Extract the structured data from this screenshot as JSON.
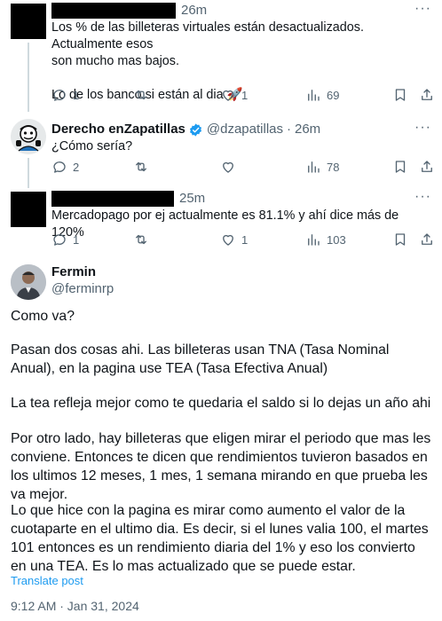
{
  "replies": [
    {
      "time": "26m",
      "text_lines": [
        "Los % de las billeteras virtuales están desactualizados. Actualmente esos",
        "son mucho mas bajos.",
        "",
        "Lo de los banco si están al dia 🚀"
      ],
      "replies_count": "1",
      "retweets_count": "",
      "likes_count": "1",
      "views_count": "69"
    },
    {
      "display_name": "Derecho enZapatillas",
      "handle": "@dzapatillas",
      "sep": "·",
      "time": "26m",
      "text_lines": [
        "¿Cómo sería?"
      ],
      "replies_count": "2",
      "retweets_count": "",
      "likes_count": "",
      "views_count": "78"
    },
    {
      "time": "25m",
      "text_lines": [
        "Mercadopago por ej actualmente es 81.1% y ahí dice más de 120%"
      ],
      "replies_count": "1",
      "retweets_count": "",
      "likes_count": "1",
      "views_count": "103"
    }
  ],
  "main_post": {
    "display_name": "Fermin",
    "handle": "@ferminrp",
    "paragraphs": [
      "Como va?",
      "Pasan dos cosas ahi. Las billeteras usan TNA (Tasa Nominal Anual), en la pagina use TEA (Tasa Efectiva Anual)",
      "La tea refleja mejor como te quedaria el saldo si lo dejas un año ahi",
      "Por otro lado, hay billeteras que eligen mirar el periodo que mas les conviene. Entonces te dicen que rendimientos tuvieron basados en los ultimos 12 meses, 1 mes, 1 semana mirando en que prueba les va mejor.",
      "Lo que hice con la pagina es mirar como aumento el valor de la cuotaparte en el ultimo dia. Es decir, si el lunes valia 100, el martes 101 entonces es un rendimiento diaria del 1% y eso los convierto en una TEA. Es lo mas actualizado que se puede estar."
    ],
    "translate_label": "Translate post",
    "timestamp": "9:12 AM · Jan 31, 2024"
  },
  "colors": {
    "accent": "#1d9bf0",
    "muted": "#536471",
    "verified": "#1d9bf0"
  }
}
